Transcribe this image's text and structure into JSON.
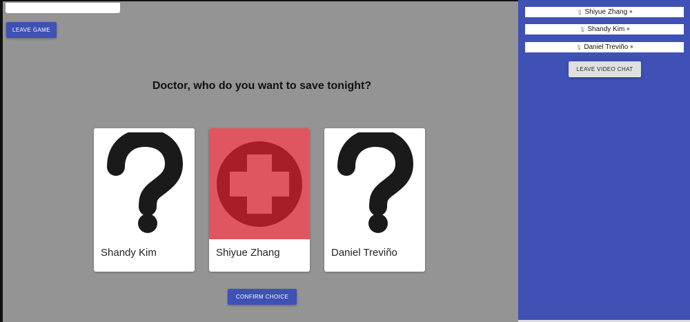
{
  "game": {
    "leave_game_label": "LEAVE GAME",
    "prompt": "Doctor, who do you want to save tonight?",
    "confirm_label": "CONFIRM CHOICE",
    "cards": [
      {
        "name": "Shandy Kim",
        "icon": "question-mark-icon",
        "selected": false
      },
      {
        "name": "Shiyue Zhang",
        "icon": "medical-cross-icon",
        "selected": true
      },
      {
        "name": "Daniel Treviño",
        "icon": "question-mark-icon",
        "selected": false
      }
    ]
  },
  "video_chat": {
    "participants": [
      {
        "name": "Shiyue Zhang",
        "mic_icon": "mic-off-icon",
        "camera_icon": "camera-off-icon"
      },
      {
        "name": "Shandy Kim",
        "mic_icon": "mic-off-icon",
        "camera_icon": "camera-off-icon"
      },
      {
        "name": "Daniel Treviño",
        "mic_icon": "mic-off-icon",
        "camera_icon": "camera-off-icon"
      }
    ],
    "leave_label": "LEAVE VIDEO CHAT"
  },
  "colors": {
    "primary": "#3f51b5",
    "background": "#949494",
    "selected_card": "#e05660",
    "cross_circle": "#a81e28"
  }
}
